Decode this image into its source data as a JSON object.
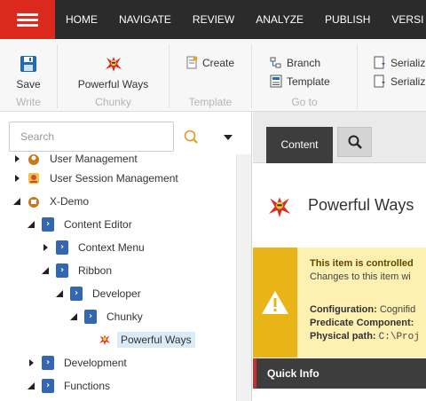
{
  "topnav": {
    "menu_icon": "hamburger-icon",
    "tabs": [
      "HOME",
      "NAVIGATE",
      "REVIEW",
      "ANALYZE",
      "PUBLISH",
      "VERSI"
    ]
  },
  "ribbon": {
    "write": {
      "label": "Write",
      "save_label": "Save",
      "icon": "save-icon"
    },
    "chunky": {
      "label": "Chunky",
      "button_label": "Powerful Ways",
      "icon": "ninja-icon"
    },
    "template": {
      "label": "Template",
      "create_label": "Create",
      "icon": "create-icon"
    },
    "goto": {
      "label": "Go to",
      "branch_label": "Branch",
      "template_label": "Template"
    },
    "serialize": {
      "items": [
        "Serializ",
        "Serializ"
      ]
    }
  },
  "search": {
    "placeholder": "Search"
  },
  "tree": {
    "items": [
      {
        "label": "User Management",
        "expanded": false
      },
      {
        "label": "User Session Management",
        "expanded": false
      },
      {
        "label": "X-Demo",
        "expanded": true
      },
      {
        "label": "Content Editor",
        "expanded": true
      },
      {
        "label": "Context Menu",
        "expanded": false
      },
      {
        "label": "Ribbon",
        "expanded": true
      },
      {
        "label": "Developer",
        "expanded": true
      },
      {
        "label": "Chunky",
        "expanded": true
      },
      {
        "label": "Powerful Ways",
        "selected": true
      },
      {
        "label": "Development",
        "expanded": false
      },
      {
        "label": "Functions",
        "expanded": true
      }
    ]
  },
  "content": {
    "tab_label": "Content",
    "item_title": "Powerful Ways",
    "warning": {
      "line1": "This item is controlled",
      "line2": "Changes to this item wi",
      "config_label": "Configuration:",
      "config_value": "Cognifid",
      "predicate_label": "Predicate Component:",
      "physical_label": "Physical path:",
      "physical_value": "C:\\Proj"
    },
    "quick_info": "Quick Info"
  },
  "colors": {
    "brand_red": "#dc291e",
    "topbar": "#2b2b2b",
    "warning_side": "#e8b418",
    "warning_bg": "#fdf0b1"
  }
}
